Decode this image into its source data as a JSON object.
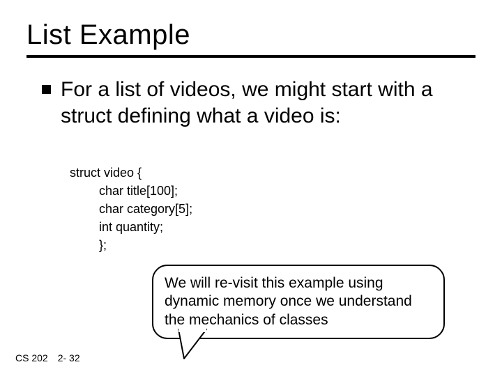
{
  "title": "List Example",
  "bullet": "For a list of videos, we might start with a struct defining what a video is:",
  "code": {
    "l0": "struct video {",
    "l1": "char title[100];",
    "l2": "char category[5];",
    "l3": "int quantity;",
    "l4": "};"
  },
  "callout": "We will re-visit this example using dynamic memory once we understand the mechanics of classes",
  "footer_course": "CS 202",
  "footer_page": "2- 32"
}
